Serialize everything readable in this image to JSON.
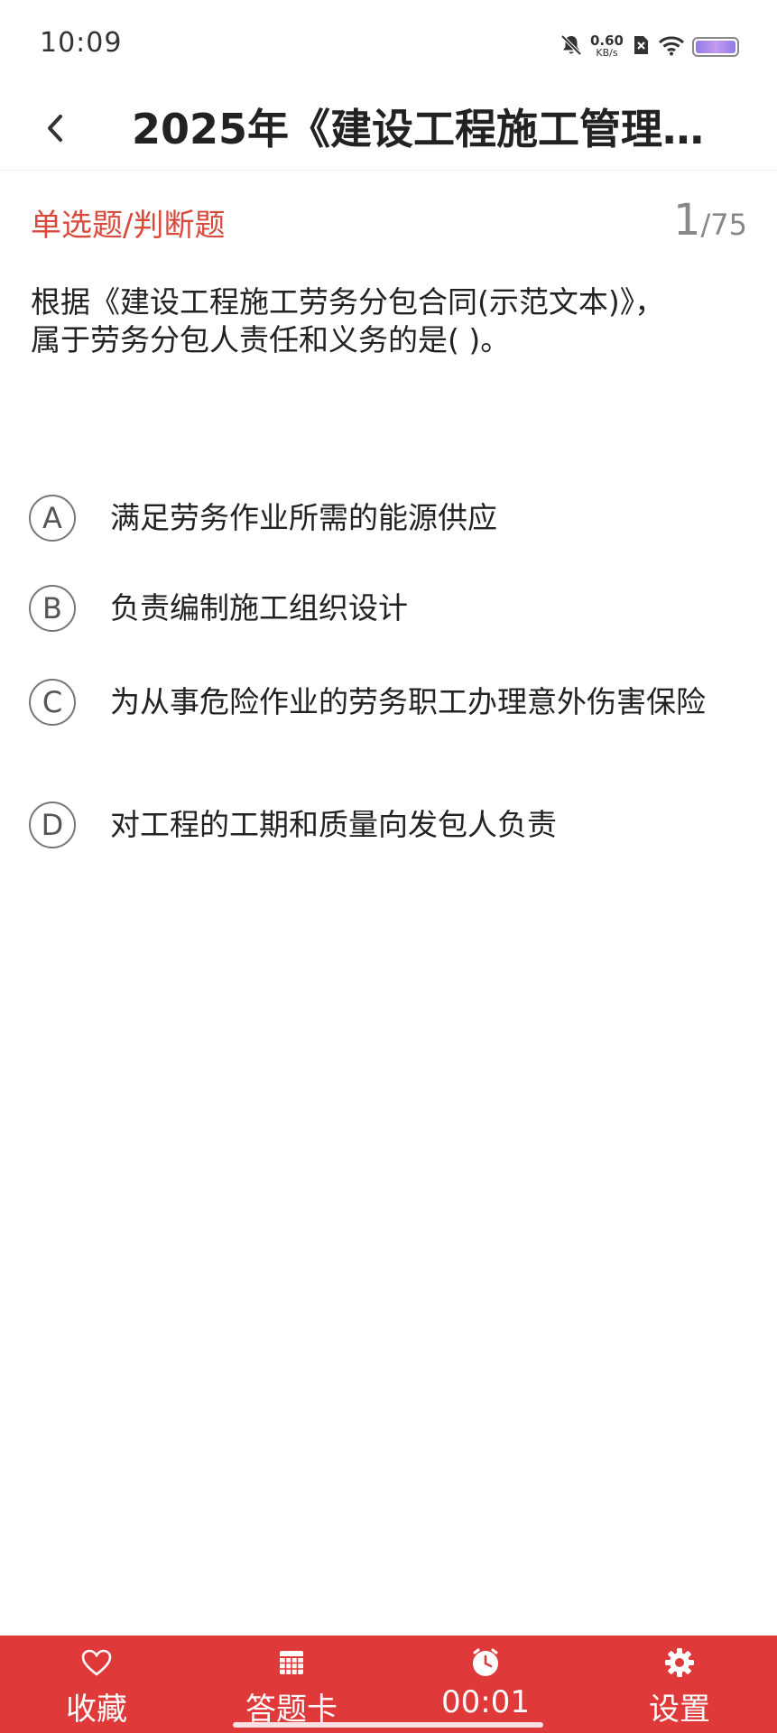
{
  "status_bar": {
    "time": "10:09",
    "net_speed_value": "0.60",
    "net_speed_unit": "KB/s",
    "icons": [
      "bell-off-icon",
      "sim-off-icon",
      "wifi-icon",
      "battery-icon"
    ]
  },
  "header": {
    "title": "2025年《建设工程施工管理…",
    "back_icon": "chevron-left-icon"
  },
  "question": {
    "type": "单选题/判断题",
    "current": "1",
    "total": "/75",
    "text": "根据《建设工程施工劳务分包合同(示范文本)》，属于劳务分包人责任和义务的是( )。"
  },
  "options": [
    {
      "letter": "A",
      "text": "满足劳务作业所需的能源供应"
    },
    {
      "letter": "B",
      "text": "负责编制施工组织设计"
    },
    {
      "letter": "C",
      "text": "为从事危险作业的劳务职工办理意外伤害保险"
    },
    {
      "letter": "D",
      "text": "对工程的工期和质量向发包人负责"
    }
  ],
  "bottom_bar": {
    "favorite_label": "收藏",
    "answer_card_label": "答题卡",
    "timer": "00:01",
    "settings_label": "设置",
    "background_color": "#e0393a"
  },
  "colors": {
    "accent": "#d94a3d",
    "bottom_bar": "#e0393a"
  }
}
